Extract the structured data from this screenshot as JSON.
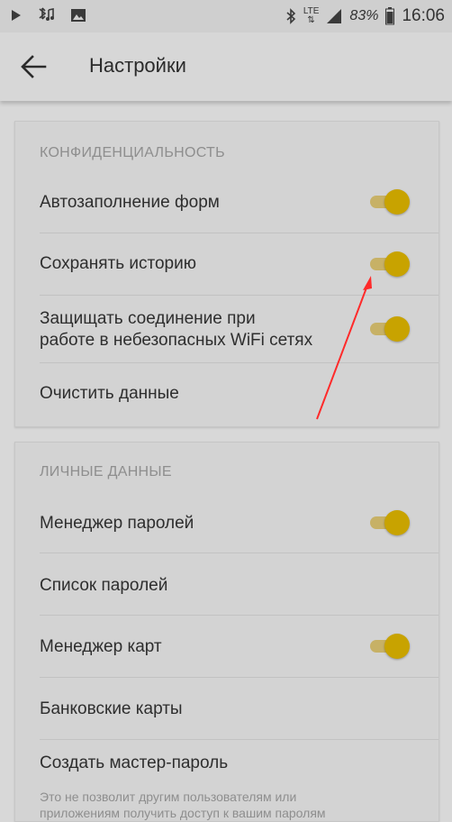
{
  "status_bar": {
    "icons": [
      "play-icon",
      "bluetooth-silent-icon",
      "image-icon",
      "bluetooth-icon",
      "lte-icon",
      "signal-icon",
      "battery-icon"
    ],
    "network": "LTE",
    "battery": "83%",
    "time": "16:06"
  },
  "app_bar": {
    "title": "Настройки",
    "back_icon": "arrow-left-icon"
  },
  "privacy": {
    "header": "КОНФИДЕНЦИАЛЬНОСТЬ",
    "items": [
      {
        "label": "Автозаполнение форм",
        "toggle": true
      },
      {
        "label": "Сохранять историю",
        "toggle": true
      },
      {
        "label": "Защищать соединение при работе в небезопасных WiFi сетях",
        "line1": "Защищать соединение при",
        "line2": "работе в небезопасных WiFi сетях",
        "toggle": true
      },
      {
        "label": "Очистить данные"
      }
    ]
  },
  "personal": {
    "header": "ЛИЧНЫЕ ДАННЫЕ",
    "items": [
      {
        "label": "Менеджер паролей",
        "toggle": true
      },
      {
        "label": "Список паролей"
      },
      {
        "label": "Менеджер карт",
        "toggle": true
      },
      {
        "label": "Банковские карты"
      },
      {
        "label": "Создать мастер-пароль"
      }
    ],
    "note_line1": "Это не позволит другим пользователям или",
    "note_line2": "приложениям получить доступ к вашим паролям"
  },
  "colors": {
    "toggle_thumb": "#c8a300",
    "toggle_track": "#c7b166",
    "annotation_arrow": "#ff2a2a"
  }
}
